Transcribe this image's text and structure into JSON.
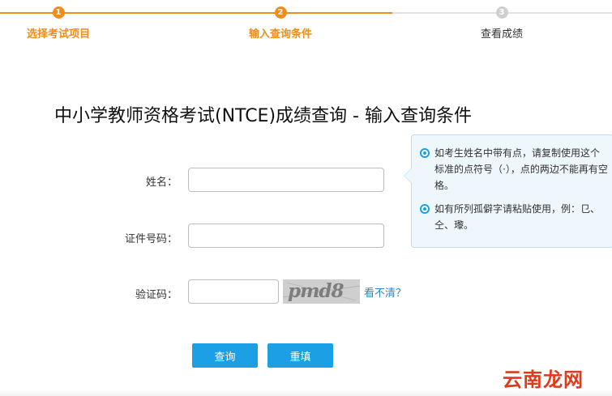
{
  "steps": [
    {
      "num": "1",
      "label": "选择考试项目",
      "state": "done"
    },
    {
      "num": "2",
      "label": "输入查询条件",
      "state": "current"
    },
    {
      "num": "3",
      "label": "查看成绩",
      "state": "todo"
    }
  ],
  "title": "中小学教师资格考试(NTCE)成绩查询 - 输入查询条件",
  "form": {
    "name_label": "姓名：",
    "name_value": "",
    "id_label": "证件号码：",
    "id_value": "",
    "captcha_label": "验证码：",
    "captcha_value": "",
    "captcha_image_text": "pmd8",
    "refresh_link": "看不清？"
  },
  "buttons": {
    "query": "查询",
    "reset": "重填"
  },
  "tips": [
    "如考生姓名中带有点，请复制使用这个标准的点符号（·），点的两边不能再有空格。",
    "如有所列孤僻字请粘贴使用，例：㔾、仝、瓈。"
  ],
  "watermark": "云南龙网",
  "colors": {
    "accent_orange": "#f08d1a",
    "button_blue": "#1d9fe6",
    "link_blue": "#2a86c6",
    "tip_bg": "#eef7fc",
    "watermark_red": "#e03a1c"
  }
}
